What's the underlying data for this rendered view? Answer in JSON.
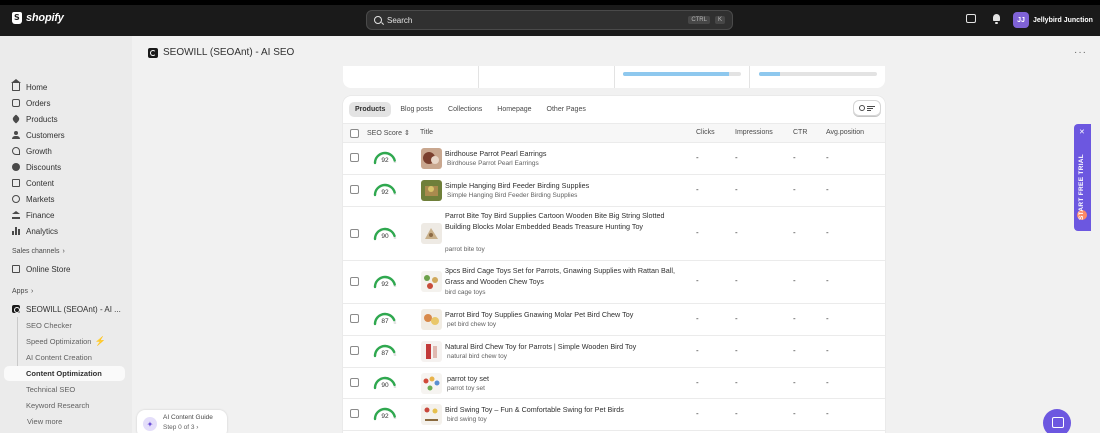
{
  "topbar": {
    "logo": "shopify",
    "search_placeholder": "Search",
    "shortcut_ctrl": "CTRL",
    "shortcut_key": "K",
    "avatar_initials": "JJ",
    "account_name": "Jellybird Junction"
  },
  "sidebar": {
    "items": [
      "Home",
      "Orders",
      "Products",
      "Customers",
      "Growth",
      "Discounts",
      "Content",
      "Markets",
      "Finance",
      "Analytics"
    ],
    "sales_channels_label": "Sales channels",
    "online_store": "Online Store",
    "apps_label": "Apps",
    "app_name": "SEOWILL (SEOAnt) - AI ...",
    "sub_items": [
      "SEO Checker",
      "Speed Optimization",
      "AI Content Creation",
      "Content Optimization",
      "Technical SEO",
      "Keyword Research",
      "View more"
    ],
    "active_sub": "Content Optimization"
  },
  "guide": {
    "title": "AI Content Guide",
    "step": "Step 0 of 3"
  },
  "page": {
    "title": "SEOWILL (SEOAnt) - AI SEO",
    "more": "···"
  },
  "tabs": [
    "Products",
    "Blog posts",
    "Collections",
    "Homepage",
    "Other Pages"
  ],
  "columns": {
    "seo_score": "SEO Score",
    "title": "Title",
    "clicks": "Clicks",
    "impressions": "Impressions",
    "ctr": "CTR",
    "avg_position": "Avg.position"
  },
  "rows": [
    {
      "score": "92",
      "score_value": 92,
      "title": "Birdhouse Parrot Pearl Earrings",
      "keyword": "Birdhouse Parrot Pearl Earrings",
      "clicks": "-",
      "impressions": "-",
      "ctr": "-",
      "avg": "-"
    },
    {
      "score": "92",
      "score_value": 92,
      "title": "Simple Hanging Bird Feeder Birding Supplies",
      "keyword": "Simple Hanging Bird Feeder Birding Supplies",
      "clicks": "-",
      "impressions": "-",
      "ctr": "-",
      "avg": "-"
    },
    {
      "score": "90",
      "score_value": 90,
      "title": "Parrot Bite Toy Bird Supplies Cartoon Wooden Bite Big String Slotted Building Blocks Molar Embedded Beads Treasure Hunting Toy",
      "keyword": "parrot bite toy",
      "clicks": "-",
      "impressions": "-",
      "ctr": "-",
      "avg": "-"
    },
    {
      "score": "92",
      "score_value": 92,
      "title": "3pcs Bird Cage Toys Set for Parrots, Gnawing Supplies with Rattan Ball, Grass and Wooden Chew Toys",
      "keyword": "bird cage toys",
      "clicks": "-",
      "impressions": "-",
      "ctr": "-",
      "avg": "-"
    },
    {
      "score": "87",
      "score_value": 87,
      "title": "Parrot Bird Toy Supplies Gnawing Molar Pet Bird Chew Toy",
      "keyword": "pet bird chew toy",
      "clicks": "-",
      "impressions": "-",
      "ctr": "-",
      "avg": "-"
    },
    {
      "score": "87",
      "score_value": 87,
      "title": "Natural Bird Chew Toy for Parrots | Simple Wooden Bird Toy",
      "keyword": "natural bird chew toy",
      "clicks": "-",
      "impressions": "-",
      "ctr": "-",
      "avg": "-"
    },
    {
      "score": "90",
      "score_value": 90,
      "title": "parrot toy set",
      "keyword": "parrot toy set",
      "clicks": "-",
      "impressions": "-",
      "ctr": "-",
      "avg": "-"
    },
    {
      "score": "92",
      "score_value": 92,
      "title": "Bird Swing Toy – Fun & Comfortable Swing for Pet Birds",
      "keyword": "bird swing toy",
      "clicks": "-",
      "impressions": "-",
      "ctr": "-",
      "avg": "-"
    }
  ],
  "summary_progress": [
    0.9,
    0.18
  ],
  "trial": "START FREE TRIAL",
  "colors": {
    "accent": "#6c57e0",
    "gauge_green": "#2fa84f",
    "progress": "#8ec8ee",
    "topbar": "#1a1a1a"
  }
}
